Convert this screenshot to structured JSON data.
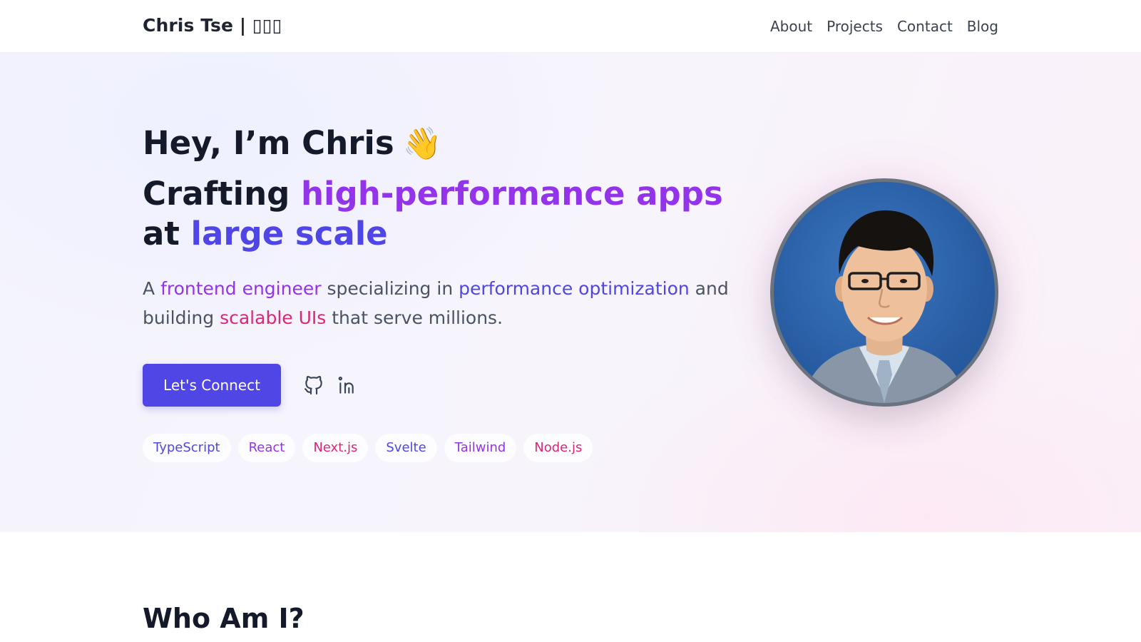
{
  "header": {
    "brand": "Chris Tse | ▯▯▯",
    "nav": [
      "About",
      "Projects",
      "Contact",
      "Blog"
    ]
  },
  "hero": {
    "greeting": "Hey, I’m Chris",
    "wave": "👋",
    "tagline": {
      "part1": "Crafting ",
      "highlight1": "high-performance apps",
      "part2": " at ",
      "highlight2": "large scale"
    },
    "description": {
      "p1": "A ",
      "h1": "frontend engineer",
      "p2": " specializing in ",
      "h2": "performance optimization",
      "p3": " and building ",
      "h3": "scalable UIs",
      "p4": " that serve millions."
    },
    "cta_label": "Let's Connect",
    "social": [
      "github-icon",
      "linkedin-icon"
    ],
    "skills": [
      {
        "label": "TypeScript",
        "color": "#4f46e5"
      },
      {
        "label": "React",
        "color": "#9333ea"
      },
      {
        "label": "Next.js",
        "color": "#db2777"
      },
      {
        "label": "Svelte",
        "color": "#4f46e5"
      },
      {
        "label": "Tailwind",
        "color": "#9333ea"
      },
      {
        "label": "Node.js",
        "color": "#db2777"
      }
    ]
  },
  "about": {
    "title": "Who Am I?"
  },
  "colors": {
    "accent": "#4f46e5",
    "purple": "#9333ea",
    "pink": "#db2777"
  }
}
